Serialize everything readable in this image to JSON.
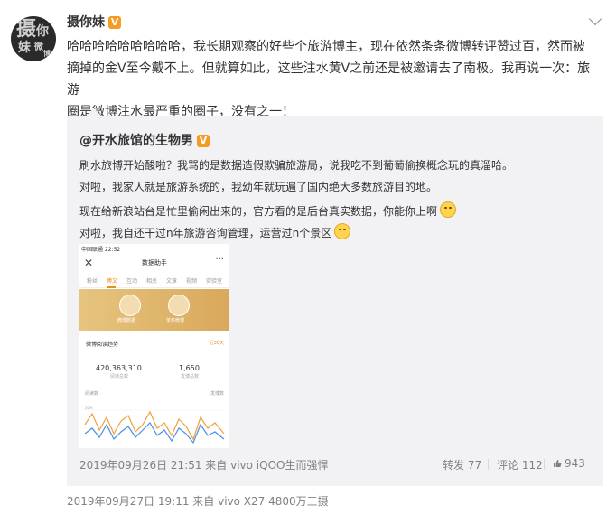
{
  "post": {
    "avatar_text": [
      "摄",
      "你",
      "妹",
      "微",
      "博"
    ],
    "username": "摄你妹",
    "v_badge": "V",
    "text_lines": [
      "哈哈哈哈哈哈哈哈哈，我长期观察的好些个旅游博主，现在依然条条微博转评赞过百，然而被",
      "摘掉的金V至今戴不上。但就算如此，这些注水黄V之前还是被邀请去了南极。我再说一次：旅游",
      "圈是微博注水最严重的圈子，没有之一！"
    ],
    "meta": "2019年09月27日 19:11  来自 vivo X27 4800万三摄"
  },
  "quote": {
    "username": "@开水旅馆的生物男",
    "v_badge": "V",
    "lines": [
      "刷水旅博开始酸啦？我骂的是数据造假欺骗旅游局，说我吃不到葡萄偷换概念玩的真溜哈。",
      "对啦，我家人就是旅游系统的，我幼年就玩遍了国内绝大多数旅游目的地。",
      "现在给新浪站台是忙里偷闲出来的，官方看的是后台真实数据，你能你上啊",
      "对啦，我自还干过n年旅游咨询管理，运营过n个景区"
    ],
    "meta": "2019年09月26日 21:51 来自 vivo iQOO生而强悍",
    "repost": "转发 77",
    "comment": "评论 112",
    "like": "943",
    "accent_color": "#f59a23"
  },
  "phone": {
    "status": "中国联通 22:52",
    "title": "数据助手",
    "close_glyph": "✕",
    "more_glyph": "···",
    "tabs": [
      "粉丝",
      "博文",
      "互动",
      "相关",
      "文章",
      "视频",
      "实验室"
    ],
    "active_tab": 1,
    "banner_labels": [
      "微博数据",
      "单条微博"
    ],
    "section_title": "微博阅读趋势",
    "section_range": "近30天",
    "stats": [
      {
        "value": "420,363,310",
        "label": "阅读总数"
      },
      {
        "value": "1,650",
        "label": "发博总数"
      }
    ],
    "axis_left": "阅读数",
    "axis_right": "发博数",
    "tick_label": "30M",
    "series_colors": [
      "#f0a23a",
      "#4a90e2"
    ]
  }
}
